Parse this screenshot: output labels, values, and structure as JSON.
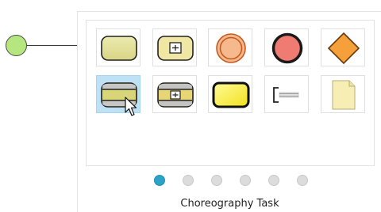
{
  "canvas": {
    "start_event_fill": "#b6e77f",
    "connector_color": "#3a3a3a"
  },
  "shape_palette": {
    "tiles": [
      {
        "name": "task",
        "icon": "rounded-rect-icon",
        "selected": false
      },
      {
        "name": "subprocess",
        "icon": "rounded-rect-plus-icon",
        "selected": false
      },
      {
        "name": "intermediate-event",
        "icon": "double-circle-icon",
        "selected": false
      },
      {
        "name": "end-event",
        "icon": "thick-circle-icon",
        "selected": false
      },
      {
        "name": "gateway",
        "icon": "diamond-icon",
        "selected": false
      },
      {
        "name": "choreography-task",
        "icon": "choreography-task-icon",
        "selected": true
      },
      {
        "name": "sub-choreography",
        "icon": "sub-choreography-icon",
        "selected": false
      },
      {
        "name": "transaction",
        "icon": "thick-rounded-rect-icon",
        "selected": false
      },
      {
        "name": "text-annotation",
        "icon": "bracket-icon",
        "selected": false
      },
      {
        "name": "data-object",
        "icon": "document-icon",
        "selected": false
      }
    ]
  },
  "pager": {
    "page_count": 6,
    "active_index": 0
  },
  "caption": "Choreography Task",
  "colors": {
    "selected_tile": "#bfe1f6",
    "active_dot": "#2aa3c6",
    "inactive_dot": "#dcdcdc"
  }
}
